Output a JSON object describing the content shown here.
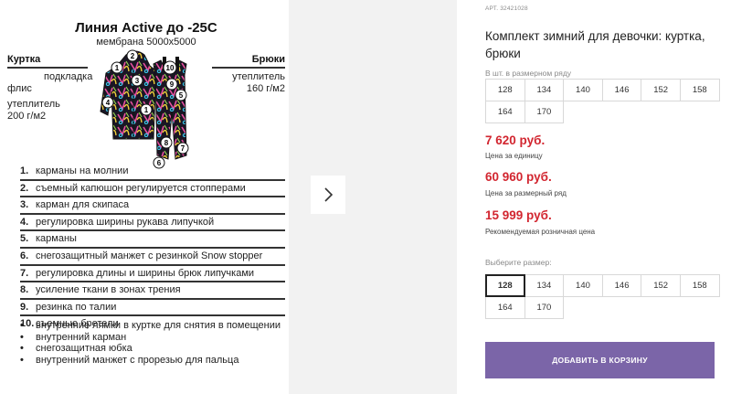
{
  "info": {
    "title": "Линия Active до -25С",
    "subtitle": "мембрана 5000x5000",
    "jacket": {
      "heading": "Куртка",
      "lines": [
        "подкладка",
        "флис",
        "утеплитель",
        "200 г/м2"
      ]
    },
    "pants": {
      "heading": "Брюки",
      "lines": [
        "утеплитель",
        "160 г/м2"
      ]
    },
    "markers": [
      "1",
      "2",
      "3",
      "4",
      "5",
      "6",
      "7",
      "8",
      "9",
      "10"
    ],
    "features": [
      {
        "num": "1.",
        "text": "карманы на молнии"
      },
      {
        "num": "2.",
        "text": "съемный капюшон регулируется стопперами"
      },
      {
        "num": "3.",
        "text": "карман для скипаса"
      },
      {
        "num": "4.",
        "text": "регулировка ширины рукава липучкой"
      },
      {
        "num": "5.",
        "text": "карманы"
      },
      {
        "num": "6.",
        "text": "снегозащитный манжет с резинкой Snow stopper"
      },
      {
        "num": "7.",
        "text": "регулировка длины и ширины брюк липучками"
      },
      {
        "num": "8.",
        "text": "усиление ткани в зонах трения"
      },
      {
        "num": "9.",
        "text": "резинка по талии"
      },
      {
        "num": "10.",
        "text": "съемные бретели"
      }
    ],
    "extras": [
      "внутренние лямки в куртке для снятия в помещении",
      "внутренний карман",
      "снегозащитная юбка",
      "внутренний манжет с прорезью для пальца"
    ]
  },
  "gallery": {
    "next_icon": "chevron-right-icon"
  },
  "product": {
    "article": "АРТ. 32421028",
    "title": "Комплект зимний для девочки: куртка, брюки",
    "pack_label": "В шт. в размерном ряду",
    "pack_sizes": [
      "128",
      "134",
      "140",
      "146",
      "152",
      "158",
      "164",
      "170"
    ],
    "price_unit": "7 620 руб.",
    "price_unit_note": "Цена за единицу",
    "price_row": "60 960 руб.",
    "price_row_note": "Цена за размерный ряд",
    "price_retail": "15 999 руб.",
    "price_retail_note": "Рекомендуемая розничная цена",
    "choose_label": "Выберите размер:",
    "choose_sizes": [
      "128",
      "134",
      "140",
      "146",
      "152",
      "158",
      "164",
      "170"
    ],
    "selected_size": "128",
    "add_button": "ДОБАВИТЬ В КОРЗИНУ"
  },
  "colors": {
    "price": "#d22630",
    "button": "#7b65a8",
    "gallery_bg": "#f2f2f2"
  }
}
